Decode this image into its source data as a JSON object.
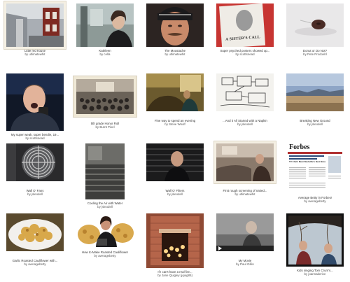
{
  "items": [
    {
      "title": "Little red house",
      "by_prefix": "by",
      "user": "ultimatewhit"
    },
    {
      "title": "Kathleen",
      "by_prefix": "by",
      "user": "cella"
    },
    {
      "title": "The Moustache",
      "by_prefix": "by",
      "user": "ultimatewhit"
    },
    {
      "title": "Super psyched posters showed up...",
      "by_prefix": "by",
      "user": "scottsnead"
    },
    {
      "title": "Donut or Do Not?",
      "by_prefix": "by",
      "user": "Pete Prodoehl"
    },
    {
      "title": "My super weak, super bendie, 19...",
      "by_prefix": "by",
      "user": "scottsnead"
    },
    {
      "title": "5th grade Honor Roll",
      "by_prefix": "by",
      "user": "Burnt Pixel"
    },
    {
      "title": "Fine way to spend an evening",
      "by_prefix": "by",
      "user": "Steve Woolf"
    },
    {
      "title": "...And it All Started with a Napkin",
      "by_prefix": "by",
      "user": "jsleodell"
    },
    {
      "title": "Breaking New Ground",
      "by_prefix": "by",
      "user": "jsleodell"
    },
    {
      "title": "Wall O' Fans",
      "by_prefix": "by",
      "user": "jsleodell"
    },
    {
      "title": "Cooling the Air with Water",
      "by_prefix": "by",
      "user": "jsleodell"
    },
    {
      "title": "Wall O' Filters",
      "by_prefix": "by",
      "user": "jsleodell"
    },
    {
      "title": "First rough screening of naked...",
      "by_prefix": "by",
      "user": "ultimatewhit"
    },
    {
      "title": "Average Betty in Forbes!",
      "by_prefix": "by",
      "user": "averagebetty"
    },
    {
      "title": "Garlic Roasted Cauliflower with...",
      "by_prefix": "by",
      "user": "averagebetty"
    },
    {
      "title": "How to Make Roasted Cauliflower",
      "by_prefix": "by",
      "user": "averagebetty"
    },
    {
      "title": "If I can't have a real fire...",
      "by_prefix": "by",
      "user": "Jane Quigley (jquig85)"
    },
    {
      "title": "My Movie",
      "by_prefix": "by",
      "user": "Paul Gillin"
    },
    {
      "title": "Kids singing Tom Crum's...",
      "by_prefix": "by",
      "user": "joannaderice"
    }
  ],
  "thumb_text": {
    "poster_headline": "A SISTER'S CALL",
    "forbes_logo": "Forbes",
    "forbes_headline": "TV Chefs Meet Nashville's Best Breakfast and Bacon"
  },
  "icons": {
    "video_play": "play-icon"
  }
}
